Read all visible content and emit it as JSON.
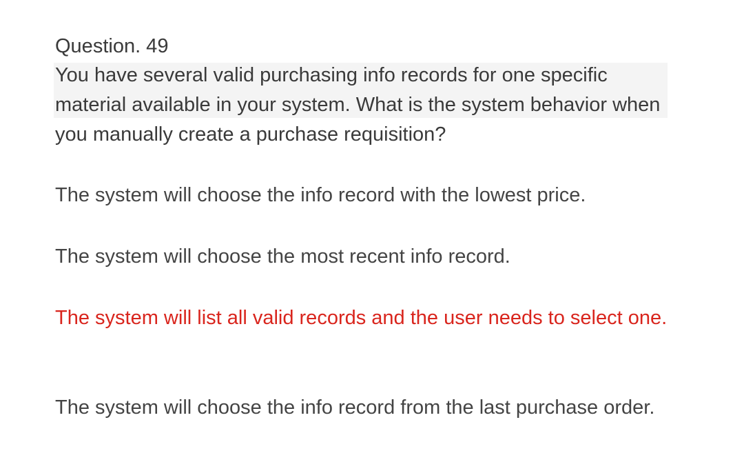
{
  "question": {
    "number": "Question. 49",
    "text": "You have several valid purchasing info records for one specific material available in your system. What is the system behavior when you manually create a purchase requisition?"
  },
  "options": [
    {
      "text": "The system will choose the info record with the lowest price.",
      "correct": false
    },
    {
      "text": "The system will choose the most recent info record.",
      "correct": false
    },
    {
      "text": "The system will list all valid records and the user needs to select one.",
      "correct": true
    },
    {
      "text": "The system will choose the info record from the last purchase order.",
      "correct": false
    }
  ],
  "colors": {
    "text": "#3a3a3a",
    "correct_answer": "#d9251d",
    "highlight": "#f4f4f4"
  }
}
